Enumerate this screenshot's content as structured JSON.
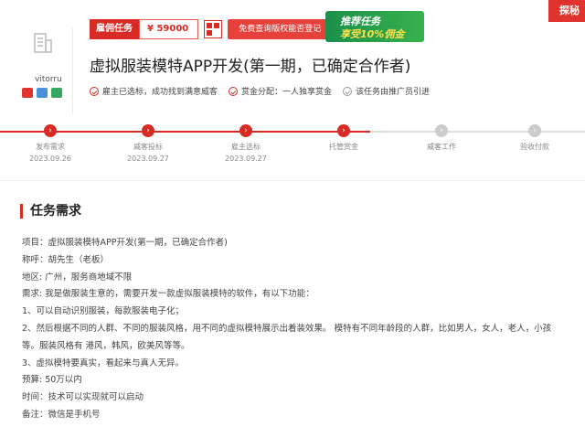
{
  "header": {
    "tag": "雇佣任务",
    "price": "¥ 59000",
    "check_button": "免费查询版权能否登记",
    "promo": {
      "line1": "推荐任务",
      "line2": "享受10%佣金"
    },
    "corner_badge": "探秘",
    "title": "虚拟服装模特APP开发(第一期，已确定合作者)",
    "info": [
      {
        "text": "雇主已选标，成功找到满意威客"
      },
      {
        "text": "赏金分配：一人独享赏金"
      },
      {
        "text": "该任务由推广员引进"
      }
    ]
  },
  "shop": {
    "name": "vitorru"
  },
  "progress": {
    "completed_steps": 4,
    "steps": [
      {
        "label": "发布需求",
        "date": "2023.09.26"
      },
      {
        "label": "威客投标",
        "date": "2023.09.27"
      },
      {
        "label": "雇主选标",
        "date": "2023.09.27"
      },
      {
        "label": "托管赏金",
        "date": ""
      },
      {
        "label": "威客工作",
        "date": ""
      },
      {
        "label": "验收付款",
        "date": ""
      }
    ]
  },
  "requirements": {
    "title": "任务需求",
    "lines": [
      "项目：虚拟服装模特APP开发(第一期，已确定合作者)",
      "称呼：胡先生（老板）",
      "地区: 广州，服务商地域不限",
      "需求: 我是做服装生意的，需要开发一款虚拟服装模特的软件，有以下功能：",
      "1、可以自动识别服装，每款服装电子化；",
      "2、然后根据不同的人群、不同的服装风格，用不同的虚拟模特展示出着装效果。 模特有不同年龄段的人群，比如男人，女人，老人，小孩",
      "等。服装风格有 港风，韩风，欧美风等等。",
      "3、虚拟模特要真实，看起来与真人无异。",
      "预算: 50万以内",
      "时间：技术可以实现就可以启动",
      "备注：微信是手机号"
    ]
  }
}
